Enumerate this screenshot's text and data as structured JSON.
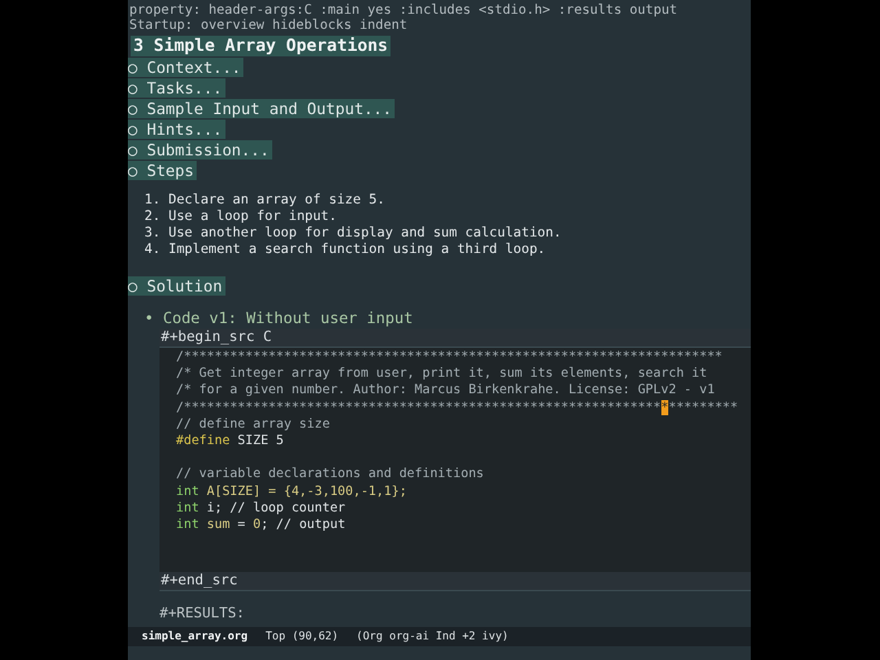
{
  "header_lines": [
    "property: header-args:C :main yes :includes <stdio.h> :results output",
    "Startup: overview hideblocks indent"
  ],
  "title": "3 Simple Array Operations",
  "sections": [
    {
      "bullet": "○",
      "label": "Context..."
    },
    {
      "bullet": "○",
      "label": "Tasks..."
    },
    {
      "bullet": "○",
      "label": "Sample Input and Output..."
    },
    {
      "bullet": "○",
      "label": "Hints..."
    },
    {
      "bullet": "○",
      "label": "Submission..."
    },
    {
      "bullet": "○",
      "label": "Steps"
    }
  ],
  "steps": [
    "1. Declare an array of size 5.",
    "2. Use a loop for input.",
    "3. Use another loop for display and sum calculation.",
    "4. Implement a search function using a third loop."
  ],
  "solution": {
    "bullet": "○",
    "label": "Solution"
  },
  "subheading": {
    "bullet": "•",
    "label": "Code v1: Without user input"
  },
  "begin_src": "#+begin_src C",
  "code_groups": [
    [
      [
        {
          "kind": "comment",
          "text": "/**********************************************************************"
        }
      ],
      [
        {
          "kind": "comment",
          "text": "/* Get integer array from user, print it, sum its elements, search it"
        }
      ],
      [
        {
          "kind": "comment",
          "text": "/* for a given number. Author: Marcus Birkenkrahe. License: GPLv2 - v1"
        }
      ],
      [
        {
          "kind": "comment",
          "text": "/**************************************************************"
        },
        {
          "kind": "cursor",
          "text": "*"
        },
        {
          "kind": "comment",
          "text": "*********"
        }
      ],
      [
        {
          "kind": "comment",
          "text": "// define array size"
        }
      ],
      [
        {
          "kind": "preproc",
          "text": "#define"
        },
        {
          "kind": "plain",
          "text": " SIZE 5"
        }
      ]
    ],
    [
      [
        {
          "kind": "comment",
          "text": "// variable declarations and definitions"
        }
      ],
      [
        {
          "kind": "keyword",
          "text": "int "
        },
        {
          "kind": "variable",
          "text": "A[SIZE] = {4,-3,100,-1,1};"
        }
      ],
      [
        {
          "kind": "keyword",
          "text": "int"
        },
        {
          "kind": "plain",
          "text": " i; // loop counter"
        }
      ],
      [
        {
          "kind": "keyword",
          "text": "int "
        },
        {
          "kind": "variable",
          "text": "sum"
        },
        {
          "kind": "plain",
          "text": " = "
        },
        {
          "kind": "variable",
          "text": "0"
        },
        {
          "kind": "plain",
          "text": "; // output"
        }
      ]
    ]
  ],
  "end_src": "#+end_src",
  "results": "#+RESULTS:",
  "mode_line": {
    "buffer": "simple_array.org",
    "position": "Top (90,62)",
    "modes": "(Org org-ai Ind +2 ivy)"
  }
}
